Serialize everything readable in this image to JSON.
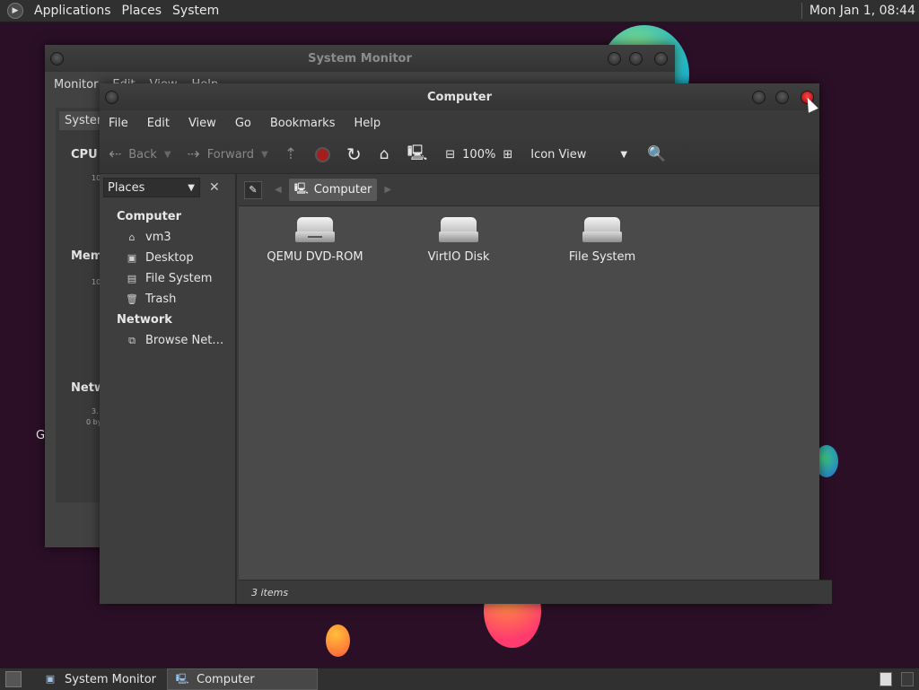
{
  "top_panel": {
    "menus": [
      "Applications",
      "Places",
      "System"
    ],
    "clock": "Mon Jan 1, 08:44"
  },
  "system_monitor": {
    "title": "System Monitor",
    "menus": [
      "Monitor",
      "Edit",
      "View",
      "Help"
    ],
    "tab": "System",
    "sections": [
      "CPU History",
      "Memory",
      "Network"
    ],
    "partial_text": {
      "cpu": "CPU I",
      "mem": "Mem",
      "net": "Netw",
      "left_g": "G",
      "tick1": "10",
      "tick2": "10",
      "net_val1": "3.",
      "net_val2": "0 by"
    }
  },
  "computer_window": {
    "title": "Computer",
    "menus": [
      "File",
      "Edit",
      "View",
      "Go",
      "Bookmarks",
      "Help"
    ],
    "toolbar": {
      "back": "Back",
      "forward": "Forward",
      "zoom": "100%",
      "view_mode": "Icon View"
    },
    "sidebar": {
      "selector": "Places",
      "categories": [
        {
          "label": "Computer",
          "items": [
            {
              "label": "vm3",
              "icon": "home-icon"
            },
            {
              "label": "Desktop",
              "icon": "desktop-icon"
            },
            {
              "label": "File System",
              "icon": "filesystem-icon"
            },
            {
              "label": "Trash",
              "icon": "trash-icon"
            }
          ]
        },
        {
          "label": "Network",
          "items": [
            {
              "label": "Browse Net…",
              "icon": "network-icon"
            }
          ]
        }
      ]
    },
    "location": {
      "crumb": "Computer"
    },
    "items": [
      {
        "label": "QEMU DVD-ROM",
        "icon": "optical-drive-icon"
      },
      {
        "label": "VirtIO Disk",
        "icon": "hard-disk-icon"
      },
      {
        "label": "File System",
        "icon": "hard-disk-icon"
      }
    ],
    "status": "3 items"
  },
  "taskbar": {
    "tasks": [
      {
        "label": "System Monitor",
        "active": false
      },
      {
        "label": "Computer",
        "active": true
      }
    ]
  }
}
